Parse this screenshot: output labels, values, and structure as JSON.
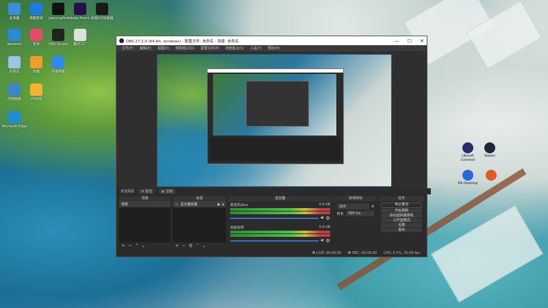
{
  "desktop": {
    "icons": [
      {
        "label": "此电脑",
        "color": "#3a8fd8"
      },
      {
        "label": "电脑管家",
        "color": "#1f7ae0"
      },
      {
        "label": "JianyingPro",
        "color": "#111111"
      },
      {
        "label": "Adobe Premi...",
        "color": "#2a0f4a"
      },
      {
        "label": "网易UU加速器",
        "color": "#1a1a1a"
      },
      {
        "label": "Network",
        "color": "#2b8ad8"
      },
      {
        "label": "秀米",
        "color": "#e84a6b"
      },
      {
        "label": "OBS Studio",
        "color": "#222222"
      },
      {
        "label": "格式工厂",
        "color": "#e0e0e0"
      },
      {
        "label": "回收站",
        "color": "#9cc6e8"
      },
      {
        "label": "热键",
        "color": "#f29a2e"
      },
      {
        "label": "百度网盘",
        "color": "#2f8af0"
      },
      {
        "label": "控制面板",
        "color": "#3a86c8"
      },
      {
        "label": "VS音频",
        "color": "#f2b233"
      },
      {
        "label": "Microsoft Edge",
        "color": "#1d8fd1"
      }
    ],
    "right_icons": [
      {
        "label": "Ubisoft Connect",
        "color": "#2a2a6a"
      },
      {
        "label": "Steam",
        "color": "#1b2838"
      },
      {
        "label": "EA Desktop",
        "color": "#2b66d8"
      },
      {
        "label": "",
        "color": "#e05a2a"
      }
    ]
  },
  "obs": {
    "title": "OBS 27.2.4 (64-bit, windows) - 配置文件: 未命名 - 场景: 未命名",
    "window_controls": {
      "minimize": "—",
      "maximize": "☐",
      "close": "✕"
    },
    "menu": [
      "文件(F)",
      "编辑(E)",
      "视图(V)",
      "停靠窗口(D)",
      "配置文件(P)",
      "场景集合(S)",
      "工具(T)",
      "帮助(H)"
    ],
    "preview_bar": {
      "no_source": "未选择源",
      "properties": "属性",
      "filters": "滤镜"
    },
    "scenes": {
      "header": "场景",
      "items": [
        "场景"
      ]
    },
    "sources": {
      "header": "来源",
      "items": [
        "显示器采集"
      ]
    },
    "mixer": {
      "header": "混音器",
      "channels": [
        {
          "name": "麦克风/Aux",
          "db": "0.0 dB"
        },
        {
          "name": "桌面音频",
          "db": "0.0 dB"
        }
      ]
    },
    "transitions": {
      "header": "转场特效",
      "type": "淡出",
      "duration_label": "时长",
      "duration": "300 ms"
    },
    "controls": {
      "header": "控件",
      "buttons": [
        "停止推流",
        "开始录制",
        "启动虚拟摄像机",
        "工作室模式",
        "设置",
        "退出"
      ]
    },
    "status": {
      "live_label": "LIVE:",
      "live_time": "00:00:00",
      "rec_label": "REC:",
      "rec_time": "00:00:00",
      "cpu": "CPU: 0.5%, 30.00 fps"
    }
  }
}
